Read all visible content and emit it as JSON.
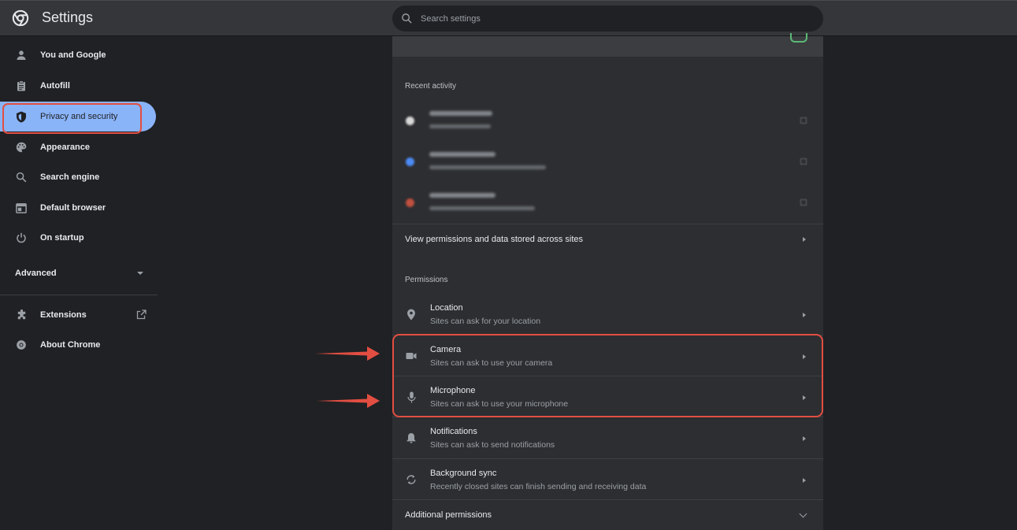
{
  "app": {
    "title": "Settings"
  },
  "search": {
    "placeholder": "Search settings"
  },
  "sidebar": {
    "items": [
      {
        "label": "You and Google",
        "icon": "person-icon"
      },
      {
        "label": "Autofill",
        "icon": "clipboard-icon"
      },
      {
        "label": "Privacy and security",
        "icon": "shield-icon",
        "active": true
      },
      {
        "label": "Appearance",
        "icon": "palette-icon"
      },
      {
        "label": "Search engine",
        "icon": "search-icon"
      },
      {
        "label": "Default browser",
        "icon": "browser-window-icon"
      },
      {
        "label": "On startup",
        "icon": "power-icon"
      }
    ],
    "advanced_label": "Advanced",
    "extensions_label": "Extensions",
    "about_label": "About Chrome"
  },
  "main": {
    "recent_activity_title": "Recent activity",
    "view_permissions_label": "View permissions and data stored across sites",
    "permissions_title": "Permissions",
    "permissions": [
      {
        "title": "Location",
        "subtitle": "Sites can ask for your location",
        "icon": "location-pin-icon"
      },
      {
        "title": "Camera",
        "subtitle": "Sites can ask to use your camera",
        "icon": "camera-icon"
      },
      {
        "title": "Microphone",
        "subtitle": "Sites can ask to use your microphone",
        "icon": "microphone-icon"
      },
      {
        "title": "Notifications",
        "subtitle": "Sites can ask to send notifications",
        "icon": "bell-icon"
      },
      {
        "title": "Background sync",
        "subtitle": "Recently closed sites can finish sending and receiving data",
        "icon": "sync-icon"
      }
    ],
    "additional_permissions_label": "Additional permissions"
  },
  "colors": {
    "accent": "#8ab4f8",
    "annotation": "#e24e42",
    "background": "#202124",
    "card": "#2d2e31"
  }
}
